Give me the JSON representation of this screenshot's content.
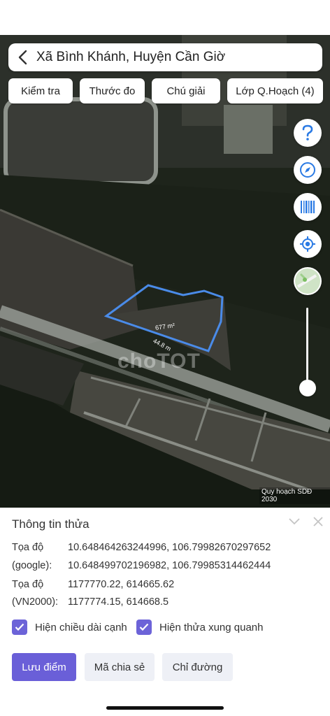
{
  "header": {
    "title": "Xã Bình Khánh, Huyện Cần Giờ"
  },
  "chips": [
    "Kiểm tra",
    "Thước đo",
    "Chú giải",
    "Lớp Q.Hoạch (4)"
  ],
  "map": {
    "parcel_area": "677 m²",
    "parcel_edge": "44.8 m",
    "watermark": "choTOT",
    "attribution": "Quy hoạch SDĐ 2030",
    "parcel_color": "#4a8be8",
    "zoom_level": 0.9
  },
  "panel": {
    "title": "Thông tin thửa",
    "rows": [
      {
        "label": "Tọa độ",
        "value": "10.648464263244996, 106.79982670297652"
      },
      {
        "label": "(google):",
        "value": "10.648499702196982, 106.79985314462444"
      },
      {
        "label": "Tọa độ",
        "value": "1177770.22, 614665.62"
      },
      {
        "label": "(VN2000):",
        "value": "1177774.15, 614668.5"
      }
    ],
    "checkbox_1": "Hiện chiều dài cạnh",
    "checkbox_2": "Hiện thửa xung quanh",
    "buttons": {
      "save": "Lưu điểm",
      "share": "Mã chia sẻ",
      "directions": "Chỉ đường"
    }
  },
  "colors": {
    "accent": "#6a5fd8",
    "fab_icon": "#2a7ae4"
  }
}
